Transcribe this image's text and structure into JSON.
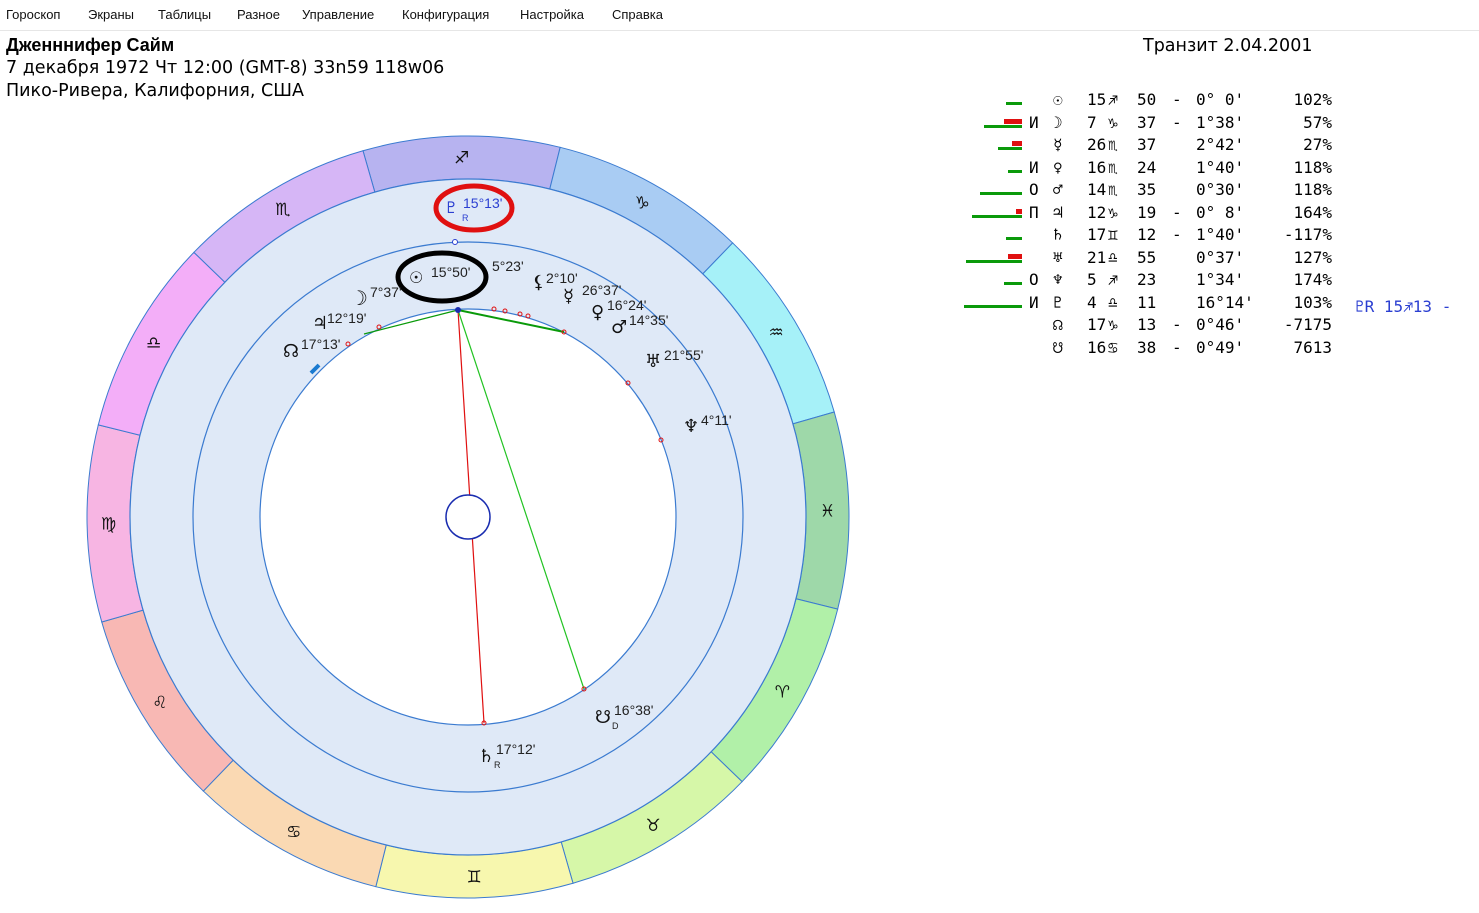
{
  "menu": [
    "Гороскоп",
    "Экраны",
    "Таблицы",
    "Разное",
    "Управление",
    "Конфигурация",
    "Настройка",
    "Справка"
  ],
  "header": {
    "name": "Дженннифер Сайм",
    "birth": "7 декабря 1972  Чт  12:00 (GMT-8) 33n59  118w06",
    "place": "Пико-Ривера, Калифорния, США",
    "transit": "Транзит  2.04.2001"
  },
  "colors": {
    "accent_red": "#e01010",
    "accent_green": "#0a9a0a",
    "transit_blue": "#2b3fd1",
    "ring_fill": "#dfe9f7",
    "ring_stroke": "#3b7bd0"
  },
  "zodiac": [
    {
      "sign": "♐",
      "color": "#b7b3f0"
    },
    {
      "sign": "♑",
      "color": "#a9ccf3"
    },
    {
      "sign": "♒",
      "color": "#a6f1f8"
    },
    {
      "sign": "♓",
      "color": "#9ed8a9"
    },
    {
      "sign": "♈",
      "color": "#b1f0a8"
    },
    {
      "sign": "♉",
      "color": "#d6f7a8"
    },
    {
      "sign": "♊",
      "color": "#f7f7ae"
    },
    {
      "sign": "♋",
      "color": "#fad9b3"
    },
    {
      "sign": "♌",
      "color": "#f8b8b4"
    },
    {
      "sign": "♍",
      "color": "#f7b5e3"
    },
    {
      "sign": "♎",
      "color": "#f3aef8"
    },
    {
      "sign": "♏",
      "color": "#d6b6f6"
    }
  ],
  "zodiac_labels": [
    "♐",
    "♑",
    "♒",
    "♓",
    "♈",
    "♉",
    "♊",
    "♋",
    "♌",
    "♍",
    "♎",
    "♏"
  ],
  "chart_markers": [
    {
      "glyph": "♇",
      "sub": "R",
      "label": "15°13'",
      "color": "#2b3fd1"
    },
    {
      "glyph": "☉",
      "label": "15°50'"
    },
    {
      "glyph": "",
      "label": "5°23'"
    },
    {
      "glyph": "☽",
      "label": "7°37'"
    },
    {
      "glyph": "⚸",
      "label": "2°10'"
    },
    {
      "glyph": "☿",
      "label": "26°37'"
    },
    {
      "glyph": "♀",
      "label": "16°24'"
    },
    {
      "glyph": "♂",
      "label": "14°35'"
    },
    {
      "glyph": "♃",
      "label": "12°19'"
    },
    {
      "glyph": "☊",
      "label": "17°13'"
    },
    {
      "glyph": "♅",
      "label": "21°55'"
    },
    {
      "glyph": "♆",
      "label": "4°11'"
    },
    {
      "glyph": "☋",
      "sub": "D",
      "label": "16°38'"
    },
    {
      "glyph": "♄",
      "sub": "R",
      "label": "17°12'"
    }
  ],
  "planets": [
    {
      "flag": "",
      "glyph": "☉",
      "deg": "15",
      "sign": "♐",
      "min": "50",
      "dash": "-",
      "orb": "0° 0'",
      "pct": "102%",
      "green": 16,
      "red": 0
    },
    {
      "flag": "И",
      "glyph": "☽",
      "deg": " 7",
      "sign": "♑",
      "min": "37",
      "dash": "-",
      "orb": "1°38'",
      "pct": "57%",
      "green": 38,
      "red": 18
    },
    {
      "flag": "",
      "glyph": "☿",
      "deg": "26",
      "sign": "♏",
      "min": "37",
      "dash": "",
      "orb": "2°42'",
      "pct": "27%",
      "green": 24,
      "red": 10
    },
    {
      "flag": "И",
      "glyph": "♀",
      "deg": "16",
      "sign": "♏",
      "min": "24",
      "dash": "",
      "orb": "1°40'",
      "pct": "118%",
      "green": 14,
      "red": 0
    },
    {
      "flag": "О",
      "glyph": "♂",
      "deg": "14",
      "sign": "♏",
      "min": "35",
      "dash": "",
      "orb": "0°30'",
      "pct": "118%",
      "green": 42,
      "red": 0
    },
    {
      "flag": "П",
      "glyph": "♃",
      "deg": "12",
      "sign": "♑",
      "min": "19",
      "dash": "-",
      "orb": "0° 8'",
      "pct": "164%",
      "green": 50,
      "red": 6
    },
    {
      "flag": "",
      "glyph": "♄",
      "deg": "17",
      "sign": "♊",
      "min": "12",
      "dash": "-",
      "orb": "1°40'",
      "pct": "-117%",
      "green": 16,
      "red": 0
    },
    {
      "flag": "",
      "glyph": "♅",
      "deg": "21",
      "sign": "♎",
      "min": "55",
      "dash": "",
      "orb": "0°37'",
      "pct": "127%",
      "green": 56,
      "red": 14
    },
    {
      "flag": "О",
      "glyph": "♆",
      "deg": " 5",
      "sign": "♐",
      "min": "23",
      "dash": "",
      "orb": "1°34'",
      "pct": "174%",
      "green": 18,
      "red": 0
    },
    {
      "flag": "И",
      "glyph": "♇",
      "deg": " 4",
      "sign": "♎",
      "min": "11",
      "dash": "",
      "orb": "16°14'",
      "pct": "103%",
      "green": 58,
      "red": 0
    },
    {
      "flag": "",
      "glyph": "☊",
      "deg": "17",
      "sign": "♑",
      "min": "13",
      "dash": "-",
      "orb": "0°46'",
      "pct": "-7175",
      "green": 0,
      "red": 0
    },
    {
      "flag": "",
      "glyph": "☋",
      "deg": "16",
      "sign": "♋",
      "min": "38",
      "dash": "-",
      "orb": "0°49'",
      "pct": "7613",
      "green": 0,
      "red": 0
    }
  ],
  "transit_extra": "♇R 15♐13 -"
}
